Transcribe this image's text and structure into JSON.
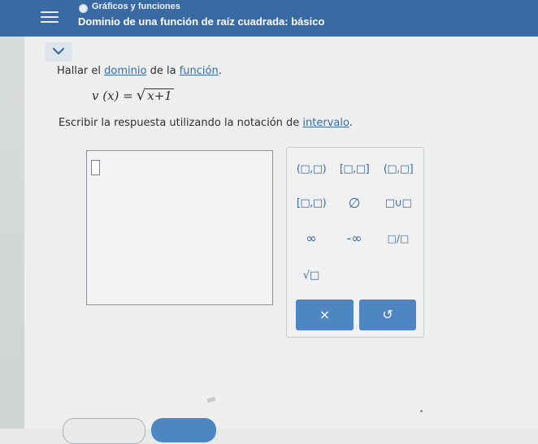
{
  "header": {
    "topic": "Gráficos y funciones",
    "title": "Dominio de una función de raíz cuadrada: básico"
  },
  "question": {
    "prefix": "Hallar el ",
    "link1": "dominio",
    "middle": " de la ",
    "link2": "función",
    "suffix": "."
  },
  "formula": {
    "lhs": "v (x) =",
    "radicand": "x+1"
  },
  "instruction": {
    "text": "Escribir la respuesta utilizando la notación de ",
    "link": "intervalo",
    "suffix": "."
  },
  "keypad": {
    "keys": [
      "(□,□)",
      "[□,□]",
      "(□,□]",
      "[□,□)",
      "∅",
      "□∪□",
      "∞",
      "-∞",
      "□/□",
      "√□"
    ],
    "clear_label": "×",
    "undo_label": "↺"
  },
  "colors": {
    "header": "#3a6aa4",
    "accent": "#4e86c4",
    "link": "#3a6aa4"
  }
}
